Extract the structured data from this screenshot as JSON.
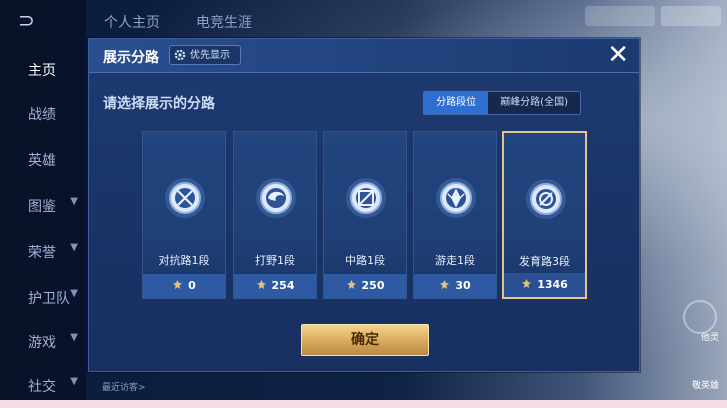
{
  "sidebar": {
    "items": [
      {
        "label": "主页",
        "active": true
      },
      {
        "label": "战绩"
      },
      {
        "label": "英雄"
      },
      {
        "label": "图鉴"
      },
      {
        "label": "荣誉"
      },
      {
        "label": "护卫队"
      },
      {
        "label": "游戏"
      },
      {
        "label": "社交"
      }
    ]
  },
  "top_tabs": [
    "个人主页",
    "电竞生涯"
  ],
  "modal": {
    "title": "展示分路",
    "priority_label": "优先显示",
    "subtitle": "请选择展示的分路",
    "toggle": [
      "分路段位",
      "巅峰分路(全国)"
    ],
    "cards": [
      {
        "label": "对抗路1段",
        "score": "0",
        "icon": "clash-lane-icon"
      },
      {
        "label": "打野1段",
        "score": "254",
        "icon": "jungle-icon"
      },
      {
        "label": "中路1段",
        "score": "250",
        "icon": "mid-lane-icon"
      },
      {
        "label": "游走1段",
        "score": "30",
        "icon": "roam-icon"
      },
      {
        "label": "发育路3段",
        "score": "1346",
        "icon": "farm-lane-icon",
        "selected": true
      }
    ],
    "confirm_label": "确定"
  },
  "footer": {
    "hint": "最近访客>"
  },
  "right_labels": [
    "他灵",
    "敬英雄"
  ],
  "colors": {
    "accent": "#2f6fd1",
    "gold": "#e6c488"
  }
}
